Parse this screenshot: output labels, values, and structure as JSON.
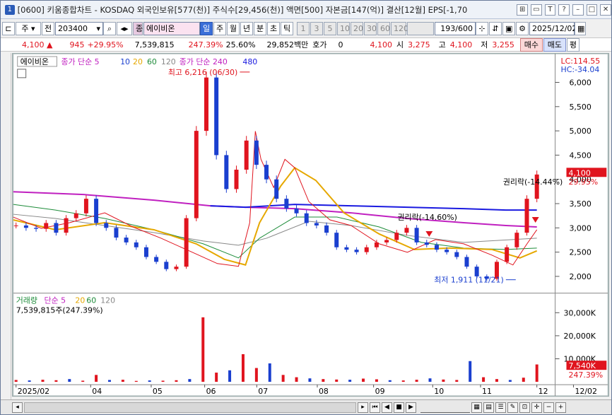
{
  "window": {
    "index": "1",
    "title": "[0600] 키움종합차트 - KOSDAQ 외국인보유[577(천)] 주식수[29,456(천)] 액면[500] 자본금[147(억)] 결산[12월] EPS[-1,70"
  },
  "toolbar": {
    "market": "주",
    "prev_label": "전",
    "code": "203400",
    "stock_name": "에이비온",
    "stock_prefix": "종",
    "periods": [
      "일",
      "주",
      "월",
      "년",
      "분",
      "초",
      "틱"
    ],
    "period_selected": "일",
    "intervals": [
      "1",
      "3",
      "5",
      "10",
      "20",
      "30",
      "60",
      "120"
    ],
    "count": "193/600",
    "date": "2025/12/02"
  },
  "quote": {
    "price": "4,100",
    "change": "945",
    "change_pct": "+29.95%",
    "volume": "7,539,815",
    "vol_ratio": "247.39%",
    "turnover": "25.60%",
    "amount": "29,852백만",
    "hoga_label": "호가",
    "hoga_val": "0",
    "hoga_price": "4,100",
    "open_label": "시",
    "open": "3,275",
    "high_label": "고",
    "high": "4,100",
    "low_label": "저",
    "low": "3,255",
    "buy_button": "매수",
    "sell_button": "매도",
    "eval_button": "평"
  },
  "legend": {
    "name": "에이비온",
    "ma_label": "종가 단순 5",
    "ma10": "10",
    "ma20": "20",
    "ma60": "60",
    "ma120": "120",
    "ma240_label": "종가 단순 240",
    "ma480": "480",
    "lc": "LC:114.55",
    "hc": "HC:-34.04"
  },
  "annotations": {
    "high": "최고 6,216 (06/30)",
    "low": "최저 1,911 (11/21)",
    "rights1": "권리락(-14.44%)",
    "rights2": "권리락(-14.60%)",
    "price_tag": "4,100",
    "price_tag_pct": "29.95%"
  },
  "volume_legend": {
    "label": "거래량",
    "ma_label": "단순 5",
    "ma20": "20",
    "ma60": "60",
    "ma120": "120",
    "value": "7,539,815주(247.39%)",
    "tag": "7,540K",
    "tag_pct": "247.39%"
  },
  "colors": {
    "up": "#e0141e",
    "down": "#1a3fcf",
    "ma5": "#e0141e",
    "ma10": "#1a3fcf",
    "ma20": "#e6a800",
    "ma60": "#1e8c3a",
    "ma120": "#888888",
    "ma240": "#c020c0",
    "ma480": "#1a1ae0"
  },
  "chart_data": {
    "type": "candlestick",
    "y_ticks": [
      "6,000",
      "5,500",
      "5,000",
      "4,500",
      "4,000",
      "3,500",
      "3,000",
      "2,500",
      "2,000"
    ],
    "ylim": [
      1800,
      6300
    ],
    "x_ticks": [
      "2025/02",
      "04",
      "05",
      "06",
      "07",
      "08",
      "09",
      "10",
      "11",
      "12",
      "12/02"
    ],
    "vol_ticks": [
      "30,000K",
      "20,000K",
      "10,000K"
    ],
    "vol_ylim": [
      0,
      33000
    ],
    "price_close": [
      3050,
      3000,
      2980,
      3100,
      2900,
      3200,
      3300,
      3600,
      3100,
      3000,
      2800,
      2700,
      2600,
      2400,
      2300,
      2150,
      2200,
      3200,
      5000,
      6100,
      4500,
      3800,
      4200,
      4800,
      4300,
      4000,
      3600,
      3400,
      3300,
      3100,
      3050,
      2900,
      2600,
      2550,
      2500,
      2600,
      2700,
      2750,
      2900,
      3000,
      2700,
      2650,
      2550,
      2500,
      2400,
      2200,
      2000,
      1950,
      2300,
      2600,
      2900,
      3600,
      4100
    ],
    "series": [
      {
        "name": "ma240",
        "values": [
          3700,
          3650,
          3600,
          3550,
          3500,
          3450,
          3420,
          3400,
          3380,
          3370,
          3360,
          3350,
          3340,
          3300,
          3250,
          3200,
          3150,
          3100,
          3050,
          3000
        ]
      },
      {
        "name": "ma480",
        "values": [
          3420,
          3410,
          3400,
          3390,
          3370,
          3360,
          3350,
          3340,
          3340,
          3340
        ]
      }
    ],
    "volume": [
      800,
      600,
      900,
      700,
      1200,
      500,
      3000,
      800,
      900,
      400,
      600,
      500,
      700,
      1200,
      28000,
      4000,
      5000,
      12000,
      6000,
      8000,
      3000,
      2000,
      1500,
      1200,
      1000,
      900,
      1400,
      1100,
      700,
      600,
      900,
      1500,
      1000,
      800,
      9000,
      2000,
      1200,
      800,
      1800,
      7540
    ]
  }
}
